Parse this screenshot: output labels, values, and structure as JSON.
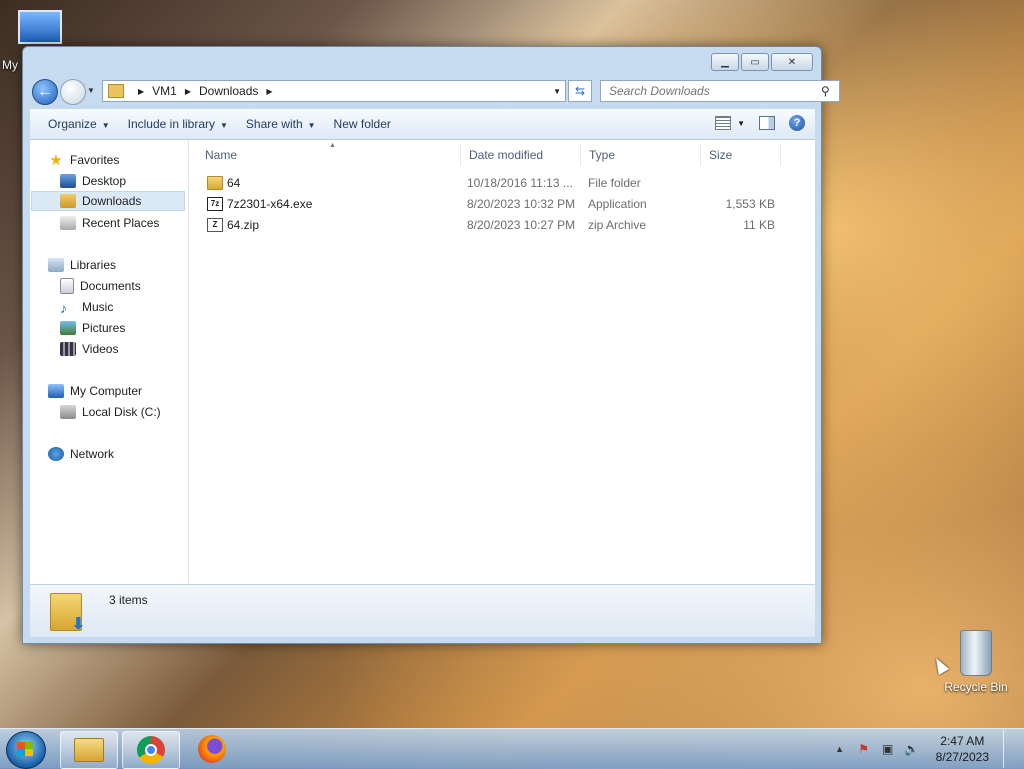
{
  "desktop": {
    "my_computer_label": "My",
    "recycle_bin_label": "Recycle Bin"
  },
  "window": {
    "caption_buttons": {
      "minimize": "▁",
      "maximize": "▭",
      "close": "✕"
    },
    "address": {
      "segments": [
        "VM1",
        "Downloads"
      ],
      "search_placeholder": "Search Downloads"
    },
    "toolbar": {
      "organize": "Organize",
      "include_in_library": "Include in library",
      "share_with": "Share with",
      "new_folder": "New folder"
    },
    "nav": {
      "favorites": "Favorites",
      "desktop": "Desktop",
      "downloads": "Downloads",
      "recent_places": "Recent Places",
      "libraries": "Libraries",
      "documents": "Documents",
      "music": "Music",
      "pictures": "Pictures",
      "videos": "Videos",
      "my_computer": "My Computer",
      "local_disk": "Local Disk (C:)",
      "network": "Network"
    },
    "columns": {
      "name": "Name",
      "date": "Date modified",
      "type": "Type",
      "size": "Size"
    },
    "files": [
      {
        "name": "64",
        "date": "10/18/2016 11:13 ...",
        "type": "File folder",
        "size": "",
        "icon": "folder-icon"
      },
      {
        "name": "7z2301-x64.exe",
        "date": "8/20/2023 10:32 PM",
        "type": "Application",
        "size": "1,553 KB",
        "icon": "exe-icon"
      },
      {
        "name": "64.zip",
        "date": "8/20/2023 10:27 PM",
        "type": "zip Archive",
        "size": "11 KB",
        "icon": "zip-icon"
      }
    ],
    "details": {
      "count": "3 items"
    }
  },
  "taskbar": {
    "time": "2:47 AM",
    "date": "8/27/2023"
  }
}
